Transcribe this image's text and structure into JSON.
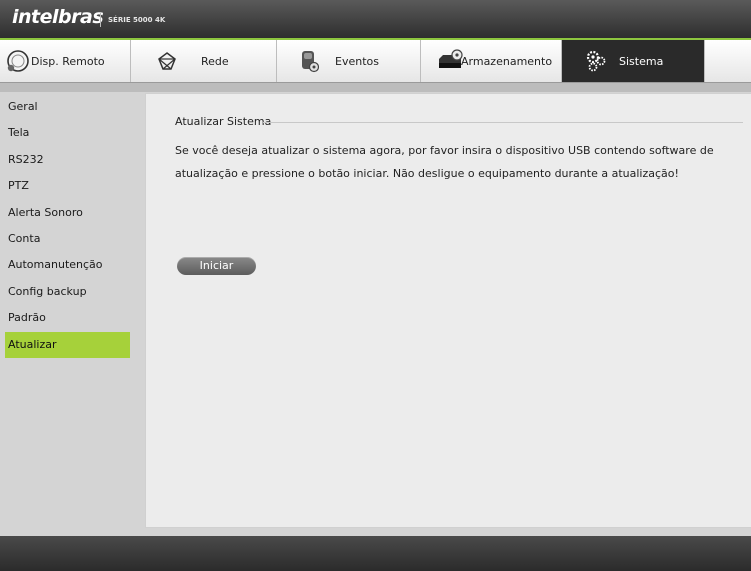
{
  "header": {
    "brand": "intelbras",
    "series": "SÉRIE 5000 4K",
    "accent_color": "#8dc63f"
  },
  "tabs": [
    {
      "label": "Disp. Remoto",
      "icon": "remote-device-icon",
      "active": false
    },
    {
      "label": "Rede",
      "icon": "network-icon",
      "active": false
    },
    {
      "label": "Eventos",
      "icon": "events-icon",
      "active": false
    },
    {
      "label": "Armazenamento",
      "icon": "storage-icon",
      "active": false
    },
    {
      "label": "Sistema",
      "icon": "gears-icon",
      "active": true
    }
  ],
  "sidebar": {
    "active_color": "#a6d13a",
    "items": [
      {
        "label": "Geral"
      },
      {
        "label": "Tela"
      },
      {
        "label": "RS232"
      },
      {
        "label": "PTZ"
      },
      {
        "label": "Alerta Sonoro"
      },
      {
        "label": "Conta"
      },
      {
        "label": "Automanutenção"
      },
      {
        "label": "Config backup"
      },
      {
        "label": "Padrão"
      },
      {
        "label": "Atualizar",
        "active": true
      }
    ]
  },
  "main": {
    "section_title": "Atualizar Sistema",
    "message": "Se você deseja atualizar o sistema agora, por favor insira o dispositivo USB contendo software de atualização e pressione o botão iniciar. Não desligue o equipamento durante a atualização!",
    "start_button": "Iniciar"
  }
}
